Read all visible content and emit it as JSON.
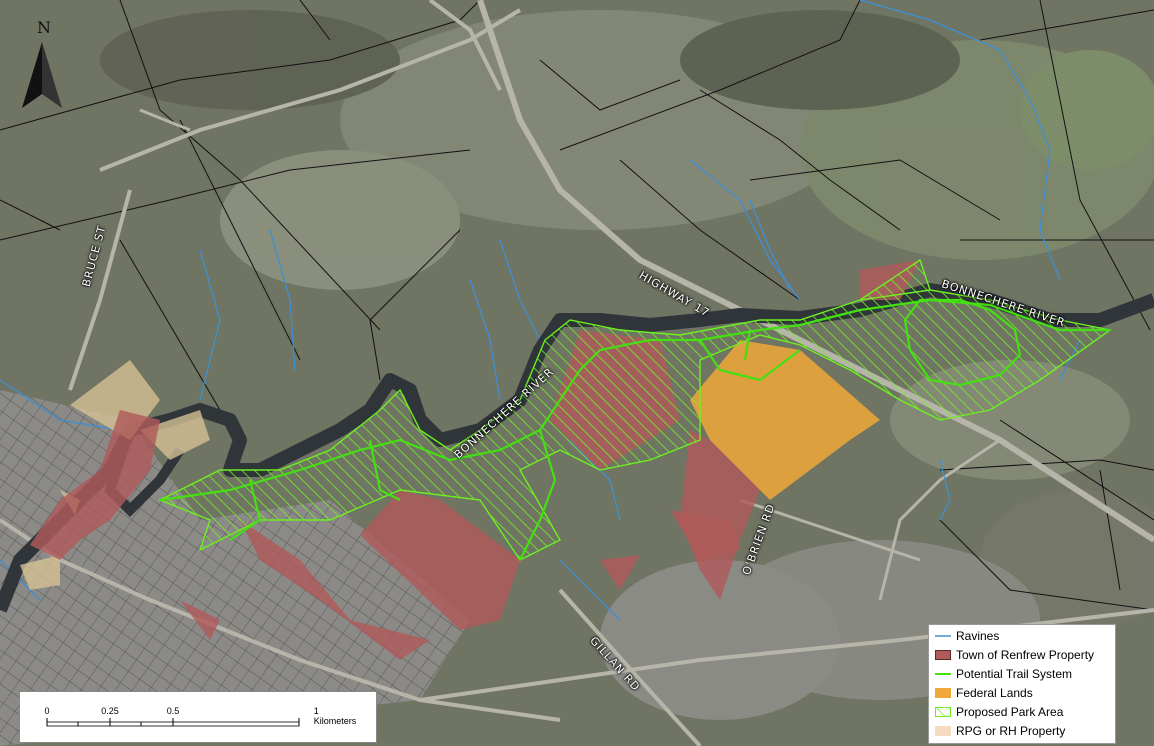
{
  "map": {
    "north_label": "N",
    "labels": {
      "bruce_st": "BRUCE ST",
      "highway_17": "HIGHWAY 17",
      "bonnechere_river_east": "BONNECHERE RIVER",
      "bonnechere_river_west": "BONNECHERE RIVER",
      "obrien_rd": "O'BRIEN RD",
      "gillan_rd": "GILLAN RD"
    },
    "scale": {
      "ticks": [
        "0",
        "0.25",
        "0.5",
        "1 Kilometers"
      ]
    }
  },
  "legend": {
    "items": [
      {
        "label": "Ravines",
        "color": "#3d8fd6",
        "symbol": "line"
      },
      {
        "label": "Town of Renfrew Property",
        "color": "#b05a5a",
        "symbol": "fill"
      },
      {
        "label": "Potential Trail System",
        "color": "#44e011",
        "symbol": "line"
      },
      {
        "label": "Federal Lands",
        "color": "#f0a838",
        "symbol": "fill"
      },
      {
        "label": "Proposed Park Area",
        "color": "#6cf020",
        "symbol": "hatch"
      },
      {
        "label": "RPG or RH Property",
        "color": "#f5dcc0",
        "symbol": "fill"
      }
    ]
  }
}
